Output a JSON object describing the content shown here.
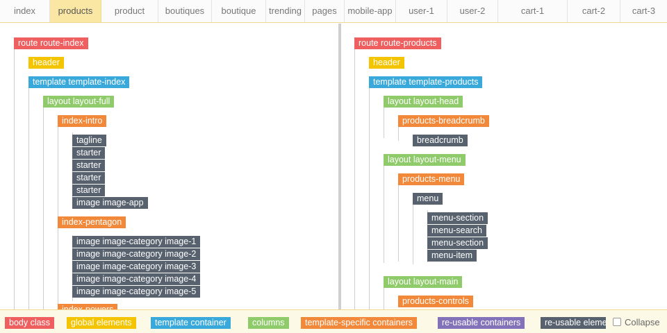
{
  "tabs": [
    {
      "label": "index",
      "active": false
    },
    {
      "label": "products",
      "active": true
    },
    {
      "label": "product",
      "active": false
    },
    {
      "label": "boutiques",
      "active": false
    },
    {
      "label": "boutique",
      "active": false
    },
    {
      "label": "trending",
      "active": false
    },
    {
      "label": "pages",
      "active": false
    },
    {
      "label": "mobile-app",
      "active": false
    },
    {
      "label": "user-1",
      "active": false
    },
    {
      "label": "user-2",
      "active": false
    },
    {
      "label": "cart-1",
      "active": false
    },
    {
      "label": "cart-2",
      "active": false
    },
    {
      "label": "cart-3",
      "active": false
    }
  ],
  "left_tree": [
    {
      "label": "route route-index",
      "kind": "red"
    },
    {
      "label": "header",
      "kind": "yellow"
    },
    {
      "label": "template template-index",
      "kind": "blue"
    },
    {
      "label": "layout layout-full",
      "kind": "green"
    },
    {
      "label": "index-intro",
      "kind": "orange"
    },
    {
      "label": "tagline",
      "kind": "slate"
    },
    {
      "label": "starter",
      "kind": "slate"
    },
    {
      "label": "starter",
      "kind": "slate"
    },
    {
      "label": "starter",
      "kind": "slate"
    },
    {
      "label": "starter",
      "kind": "slate"
    },
    {
      "label": "image image-app",
      "kind": "slate"
    },
    {
      "label": "index-pentagon",
      "kind": "orange"
    },
    {
      "label": "image image-category image-1",
      "kind": "slate"
    },
    {
      "label": "image image-category image-2",
      "kind": "slate"
    },
    {
      "label": "image image-category image-3",
      "kind": "slate"
    },
    {
      "label": "image image-category image-4",
      "kind": "slate"
    },
    {
      "label": "image image-category image-5",
      "kind": "slate"
    },
    {
      "label": "index-powers",
      "kind": "orange"
    }
  ],
  "right_tree": [
    {
      "label": "route route-products",
      "kind": "red"
    },
    {
      "label": "header",
      "kind": "yellow"
    },
    {
      "label": "template template-products",
      "kind": "blue"
    },
    {
      "label": "layout layout-head",
      "kind": "green"
    },
    {
      "label": "products-breadcrumb",
      "kind": "orange"
    },
    {
      "label": "breadcrumb",
      "kind": "slate"
    },
    {
      "label": "layout layout-menu",
      "kind": "green"
    },
    {
      "label": "products-menu",
      "kind": "orange"
    },
    {
      "label": "menu",
      "kind": "slate"
    },
    {
      "label": "menu-section",
      "kind": "slate"
    },
    {
      "label": "menu-search",
      "kind": "slate"
    },
    {
      "label": "menu-section",
      "kind": "slate"
    },
    {
      "label": "menu-item",
      "kind": "slate"
    },
    {
      "label": "layout layout-main",
      "kind": "green"
    },
    {
      "label": "products-controls",
      "kind": "orange"
    }
  ],
  "legend": [
    {
      "label": "body class",
      "kind": "red"
    },
    {
      "label": "global elements",
      "kind": "yellow"
    },
    {
      "label": "template container",
      "kind": "blue"
    },
    {
      "label": "columns",
      "kind": "green"
    },
    {
      "label": "template-specific containers",
      "kind": "orange"
    },
    {
      "label": "re-usable containers",
      "kind": "purple"
    },
    {
      "label": "re-usable elements",
      "kind": "slate"
    }
  ],
  "collapse_label": "Collapse",
  "colors": {
    "red": "#ef5f5f",
    "yellow": "#f5c400",
    "blue": "#39a9dc",
    "green": "#8fcb6a",
    "orange": "#f2893a",
    "purple": "#8272b9",
    "slate": "#58626f",
    "active_tab": "#fbe7a4"
  }
}
